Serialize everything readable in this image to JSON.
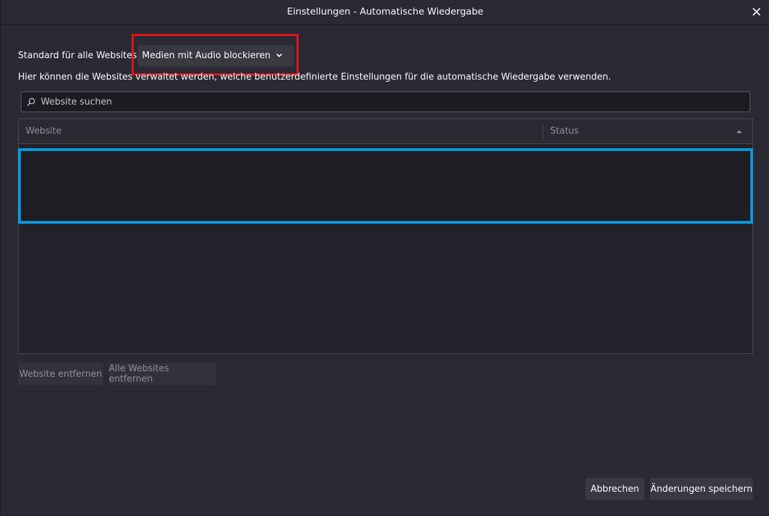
{
  "window": {
    "title": "Einstellungen - Automatische Wiedergabe"
  },
  "default_setting": {
    "label": "Standard für alle Websites:",
    "selected_value": "Medien mit Audio blockieren"
  },
  "description": "Hier können die Websites verwaltet werden, welche benutzerdefinierte Einstellungen für die automatische Wiedergabe verwenden.",
  "search": {
    "placeholder": "Website suchen",
    "value": ""
  },
  "table": {
    "columns": [
      "Website",
      "Status"
    ],
    "rows": []
  },
  "buttons": {
    "remove_site": "Website entfernen",
    "remove_all_sites": "Alle Websites entfernen",
    "cancel": "Abbrechen",
    "save": "Änderungen speichern"
  },
  "icons": {
    "close": "close-icon",
    "chevron": "chevron-down-icon",
    "search": "search-icon",
    "sort": "sort-ascending-icon"
  },
  "colors": {
    "background": "#2b2a33",
    "highlight_red": "#e0141e",
    "highlight_blue": "#0a99dc"
  }
}
